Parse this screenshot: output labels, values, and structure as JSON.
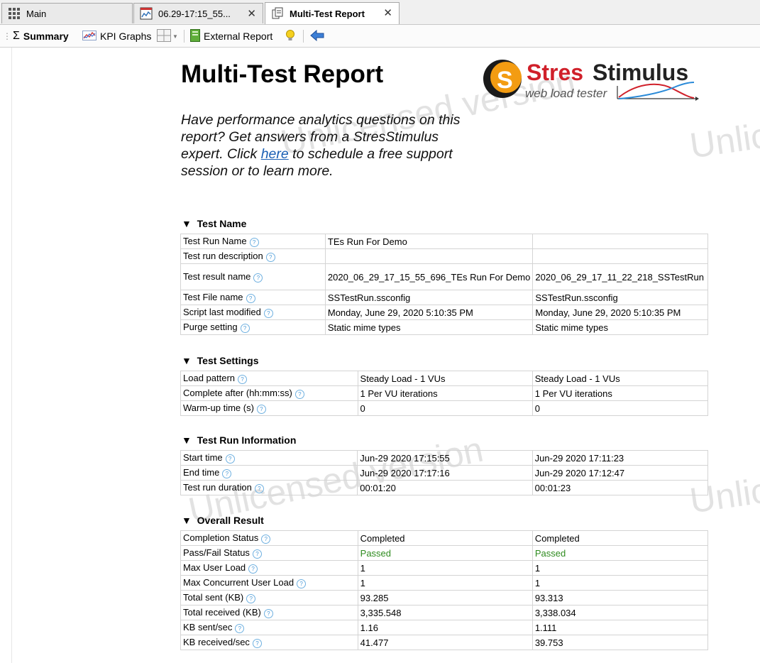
{
  "tabs": [
    {
      "label": "Main",
      "icon": "grid-icon"
    },
    {
      "label": "06.29-17:15_55...",
      "icon": "report-chart-icon"
    },
    {
      "label": "Multi-Test Report",
      "icon": "multi-report-icon"
    }
  ],
  "toolbar": {
    "summary": "Summary",
    "kpi_graphs": "KPI Graphs",
    "external_report": "External Report"
  },
  "watermark": {
    "text1": "Unlicensed version",
    "text2": "Unlicensed version",
    "text3": "Unlic",
    "text4": "Unlic"
  },
  "logo": {
    "brand": "StresStimulus",
    "tagline": "web load tester",
    "letter": "S"
  },
  "report": {
    "title": "Multi-Test Report",
    "promo_before": "Have performance analytics questions on this report? Get answers from a StresStimulus expert. Click ",
    "promo_link": "here",
    "promo_after": " to schedule a free support session or to learn more."
  },
  "sections": [
    {
      "title": "Test Name",
      "rows": [
        [
          "Test Run Name",
          "TEs Run For Demo",
          ""
        ],
        [
          "Test run description",
          "",
          ""
        ],
        [
          "Test result name",
          "2020_06_29_17_15_55_696_TEs Run For Demo",
          "2020_06_29_17_11_22_218_SSTestRun"
        ],
        [
          "Test File name",
          "SSTestRun.ssconfig",
          "SSTestRun.ssconfig"
        ],
        [
          "Script last modified",
          "Monday, June 29, 2020 5:10:35 PM",
          "Monday, June 29, 2020 5:10:35 PM"
        ],
        [
          "Purge setting",
          "Static mime types",
          "Static mime types"
        ]
      ]
    },
    {
      "title": "Test Settings",
      "rows": [
        [
          "Load pattern",
          "Steady Load - 1 VUs",
          "Steady Load - 1 VUs"
        ],
        [
          "Complete after (hh:mm:ss)",
          "1 Per VU iterations",
          "1 Per VU iterations"
        ],
        [
          "Warm-up time (s)",
          "0",
          "0"
        ]
      ]
    },
    {
      "title": "Test Run Information",
      "rows": [
        [
          "Start time",
          "Jun-29 2020 17:15:55",
          "Jun-29 2020 17:11:23"
        ],
        [
          "End time",
          "Jun-29 2020 17:17:16",
          "Jun-29 2020 17:12:47"
        ],
        [
          "Test run duration",
          "00:01:20",
          "00:01:23"
        ]
      ]
    },
    {
      "title": "Overall Result",
      "rows": [
        [
          "Completion Status",
          "Completed",
          "Completed"
        ],
        [
          "Pass/Fail Status",
          "Passed",
          "Passed"
        ],
        [
          "Max User Load",
          "1",
          "1"
        ],
        [
          "Max Concurrent User Load",
          "1",
          "1"
        ],
        [
          "Total sent (KB)",
          "93.285",
          "93.313"
        ],
        [
          "Total received (KB)",
          "3,335.548",
          "3,338.034"
        ],
        [
          "KB sent/sec",
          "1.16",
          "1.111"
        ],
        [
          "KB received/sec",
          "41.477",
          "39.753"
        ]
      ]
    }
  ],
  "colors": {
    "passed": "#2e8b1e",
    "link": "#1a5fb4",
    "logo_red": "#d0202a"
  }
}
